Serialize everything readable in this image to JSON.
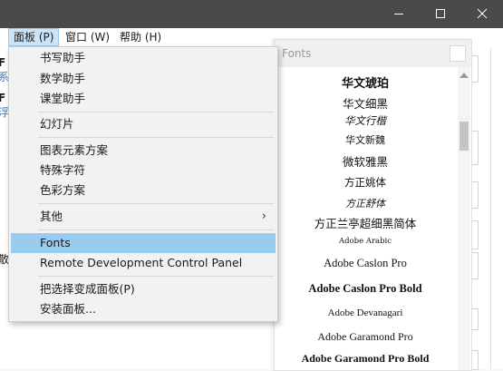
{
  "menubar": {
    "items": [
      {
        "label": "面板 (P)",
        "active": true
      },
      {
        "label": "窗口 (W)",
        "active": false
      },
      {
        "label": "帮助 (H)",
        "active": false
      }
    ]
  },
  "side_fragments": [
    "F",
    "系",
    "F",
    "浮",
    "散"
  ],
  "panel_menu": {
    "items": [
      {
        "label": "书写助手"
      },
      {
        "label": "数学助手"
      },
      {
        "label": "课堂助手"
      },
      {
        "label": "幻灯片"
      },
      {
        "label": "图表元素方案"
      },
      {
        "label": "特殊字符"
      },
      {
        "label": "色彩方案"
      },
      {
        "label": "其他",
        "submenu_glyph": "›"
      },
      {
        "label": "Fonts",
        "highlighted": true
      },
      {
        "label": "Remote Development Control Panel"
      },
      {
        "label": "把选择变成面板(P)"
      },
      {
        "label": "安装面板..."
      }
    ]
  },
  "fonts_panel": {
    "title": "Fonts",
    "fonts": [
      "华文琥珀",
      "华文细黑",
      "华文行楷",
      "华文新魏",
      "微软雅黑",
      "方正姚体",
      "方正舒体",
      "方正兰亭超细黑简体",
      "Adobe Arabic",
      "Adobe Caslon Pro",
      "Adobe Caslon Pro Bold",
      "Adobe Devanagari",
      "Adobe Garamond Pro",
      "Adobe Garamond Pro Bold"
    ]
  },
  "colors": {
    "titlebar": "#4a4a4a",
    "menu_highlight": "#99ccee",
    "menubar_active": "#cce4f7"
  },
  "icons": [
    "minimize-icon",
    "maximize-icon",
    "close-icon",
    "chevron-right-icon"
  ]
}
